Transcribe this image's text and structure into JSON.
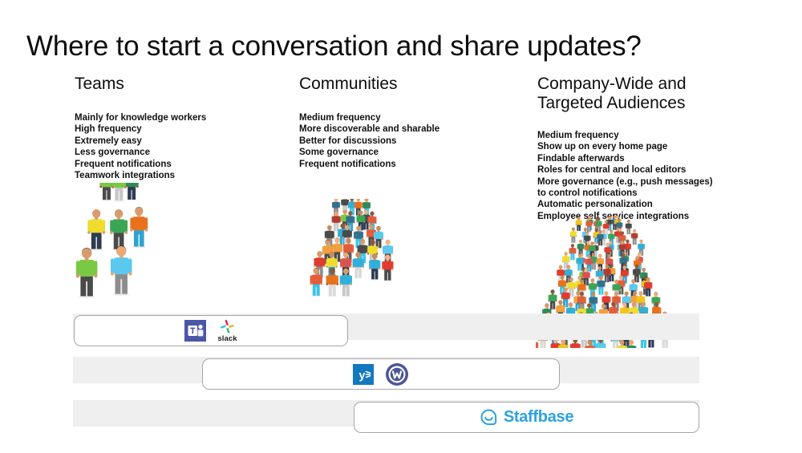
{
  "slide": {
    "title": "Where to start a conversation and share updates?"
  },
  "columns": [
    {
      "id": "teams",
      "heading": "Teams",
      "bullets": [
        "Mainly for knowledge workers",
        "High frequency",
        "Extremely easy",
        "Less governance",
        "Frequent notifications",
        "Teamwork integrations"
      ],
      "illustration": "small-group-of-people-illustration",
      "crowd_size": "small"
    },
    {
      "id": "communities",
      "heading": "Communities",
      "bullets": [
        "Medium frequency",
        "More discoverable and sharable",
        "Better for discussions",
        "Some governance",
        "Frequent notifications"
      ],
      "illustration": "medium-crowd-of-people-illustration",
      "crowd_size": "medium"
    },
    {
      "id": "company-wide",
      "heading": "Company-Wide and\nTargeted Audiences",
      "bullets": [
        "Medium frequency",
        "Show up on every home page",
        "Findable afterwards",
        "Roles for central and local editors",
        "More governance (e.g., push messages)",
        "to control notifications",
        "Automatic personalization",
        "Employee self service integrations"
      ],
      "illustration": "large-crowd-of-people-illustration",
      "crowd_size": "large"
    }
  ],
  "product_rows": [
    {
      "id": "row-teams-tools",
      "logos": [
        {
          "name": "microsoft-teams-logo",
          "label": "Microsoft Teams",
          "wordmark": ""
        },
        {
          "name": "slack-logo",
          "label": "Slack",
          "wordmark": "slack"
        }
      ]
    },
    {
      "id": "row-community-tools",
      "logos": [
        {
          "name": "yammer-logo",
          "label": "Yammer",
          "wordmark": ""
        },
        {
          "name": "workplace-logo",
          "label": "Workplace",
          "wordmark": ""
        }
      ]
    },
    {
      "id": "row-intranet-tools",
      "logos": [
        {
          "name": "staffbase-logo",
          "label": "Staffbase",
          "wordmark": "Staffbase"
        }
      ]
    }
  ],
  "colors": {
    "background": "#ffffff",
    "text": "#111111",
    "track": "#efefef",
    "pill_border": "#a6a6a6",
    "teams_blue": "#4a56a6",
    "yammer_blue": "#1279bf",
    "workplace_blue": "#4b559a",
    "staffbase_blue": "#2ca2e0"
  }
}
